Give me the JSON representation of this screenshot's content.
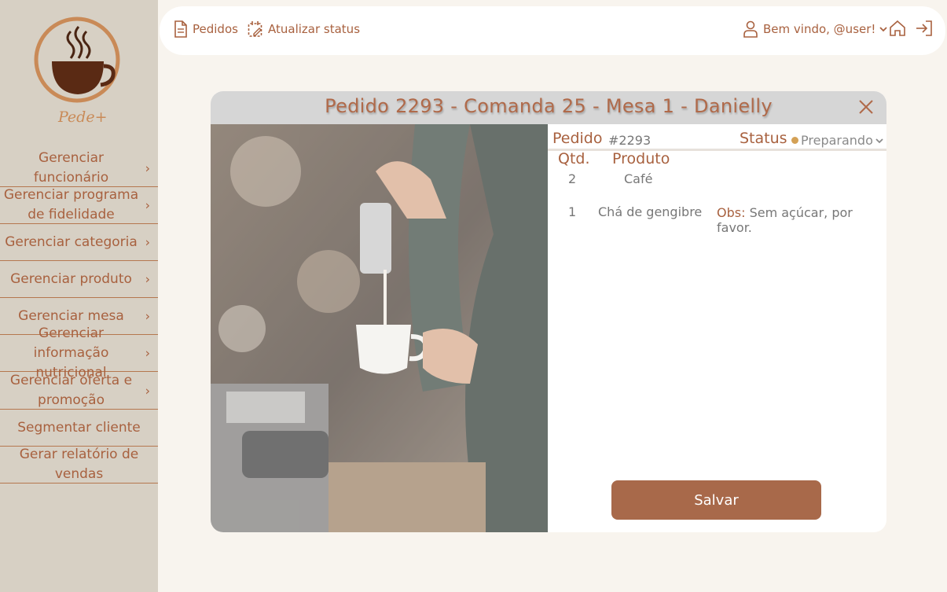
{
  "app": {
    "logo_text": "Pede+"
  },
  "sidebar": {
    "items": [
      {
        "label": "Gerenciar funcionário",
        "chevron": true
      },
      {
        "label": "Gerenciar programa de fidelidade",
        "chevron": true
      },
      {
        "label": "Gerenciar categoria",
        "chevron": true
      },
      {
        "label": "Gerenciar produto",
        "chevron": true
      },
      {
        "label": "Gerenciar mesa",
        "chevron": true
      },
      {
        "label": "Gerenciar informação nutricional",
        "chevron": true
      },
      {
        "label": "Gerenciar oferta e promoção",
        "chevron": true
      },
      {
        "label": "Segmentar cliente",
        "chevron": false
      },
      {
        "label": "Gerar relatório de vendas",
        "chevron": false
      }
    ]
  },
  "header": {
    "orders_label": "Pedidos",
    "update_status_label": "Atualizar status",
    "welcome_label": "Bem vindo, @user!"
  },
  "modal": {
    "title": "Pedido 2293 - Comanda 25 - Mesa 1 - Danielly",
    "order_label": "Pedido",
    "order_number": "#2293",
    "status_label": "Status",
    "status_value": "Preparando",
    "status_color": "#d4a156",
    "col_qty": "Qtd.",
    "col_product": "Produto",
    "items": [
      {
        "qty": "2",
        "product": "Café",
        "obs_label": "",
        "obs": ""
      },
      {
        "qty": "1",
        "product": "Chá de gengibre",
        "obs_label": "Obs:",
        "obs": "Sem açúcar, por favor."
      }
    ],
    "save_label": "Salvar"
  },
  "colors": {
    "accent": "#a8613f",
    "sidebar_bg": "#d7d0c4",
    "page_bg": "#f8f4ee",
    "button_bg": "#a8694a"
  }
}
